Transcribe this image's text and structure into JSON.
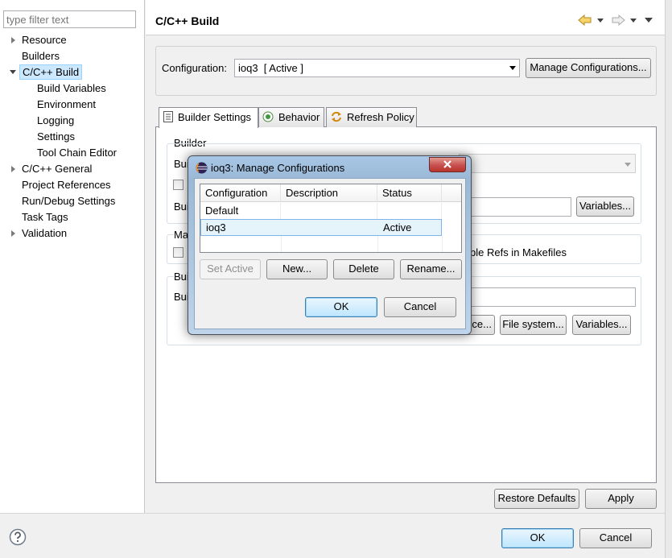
{
  "filter": {
    "placeholder": "type filter text"
  },
  "tree": {
    "items": [
      {
        "label": "Resource"
      },
      {
        "label": "Builders"
      },
      {
        "label": "C/C++ Build"
      },
      {
        "label": "Build Variables"
      },
      {
        "label": "Environment"
      },
      {
        "label": "Logging"
      },
      {
        "label": "Settings"
      },
      {
        "label": "Tool Chain Editor"
      },
      {
        "label": "C/C++ General"
      },
      {
        "label": "Project References"
      },
      {
        "label": "Run/Debug Settings"
      },
      {
        "label": "Task Tags"
      },
      {
        "label": "Validation"
      }
    ]
  },
  "page": {
    "title": "C/C++ Build"
  },
  "config": {
    "label": "Configuration:",
    "value": "ioq3  [ Active ]",
    "manage_label": "Manage Configurations..."
  },
  "tabs": [
    {
      "label": "Builder Settings"
    },
    {
      "label": "Behavior"
    },
    {
      "label": "Refresh Policy"
    }
  ],
  "builder": {
    "group_label": "Builder",
    "row1_fragment": "Bui",
    "row2_fragment": "Bui",
    "variables_label": "Variables..."
  },
  "makefile": {
    "group_fragment": "Ma",
    "option_tail": "ble Refs in Makefiles"
  },
  "build_loc": {
    "group_fragment": "Bui",
    "row_fragment": "Buil",
    "workspace_fragment": "ce...",
    "filesystem_label": "File system...",
    "variables_label": "Variables..."
  },
  "footer": {
    "restore_label": "Restore Defaults",
    "apply_label": "Apply",
    "ok_label": "OK",
    "cancel_label": "Cancel"
  },
  "dialog": {
    "title": "ioq3: Manage Configurations",
    "columns": [
      "Configuration",
      "Description",
      "Status"
    ],
    "rows": [
      {
        "configuration": "Default",
        "description": "",
        "status": ""
      },
      {
        "configuration": "ioq3",
        "description": "",
        "status": "Active"
      }
    ],
    "set_active_label": "Set Active",
    "new_label": "New...",
    "delete_label": "Delete",
    "rename_label": "Rename...",
    "ok_label": "OK",
    "cancel_label": "Cancel"
  },
  "colors": {
    "selection": "#cce8ff",
    "close_button": "#c75050",
    "accent": "#3c7fb1"
  },
  "icons": {
    "help": "question-circle-icon",
    "back": "back-arrow-icon",
    "forward": "forward-arrow-icon",
    "menu": "view-menu-icon",
    "eclipse": "eclipse-logo-icon"
  }
}
